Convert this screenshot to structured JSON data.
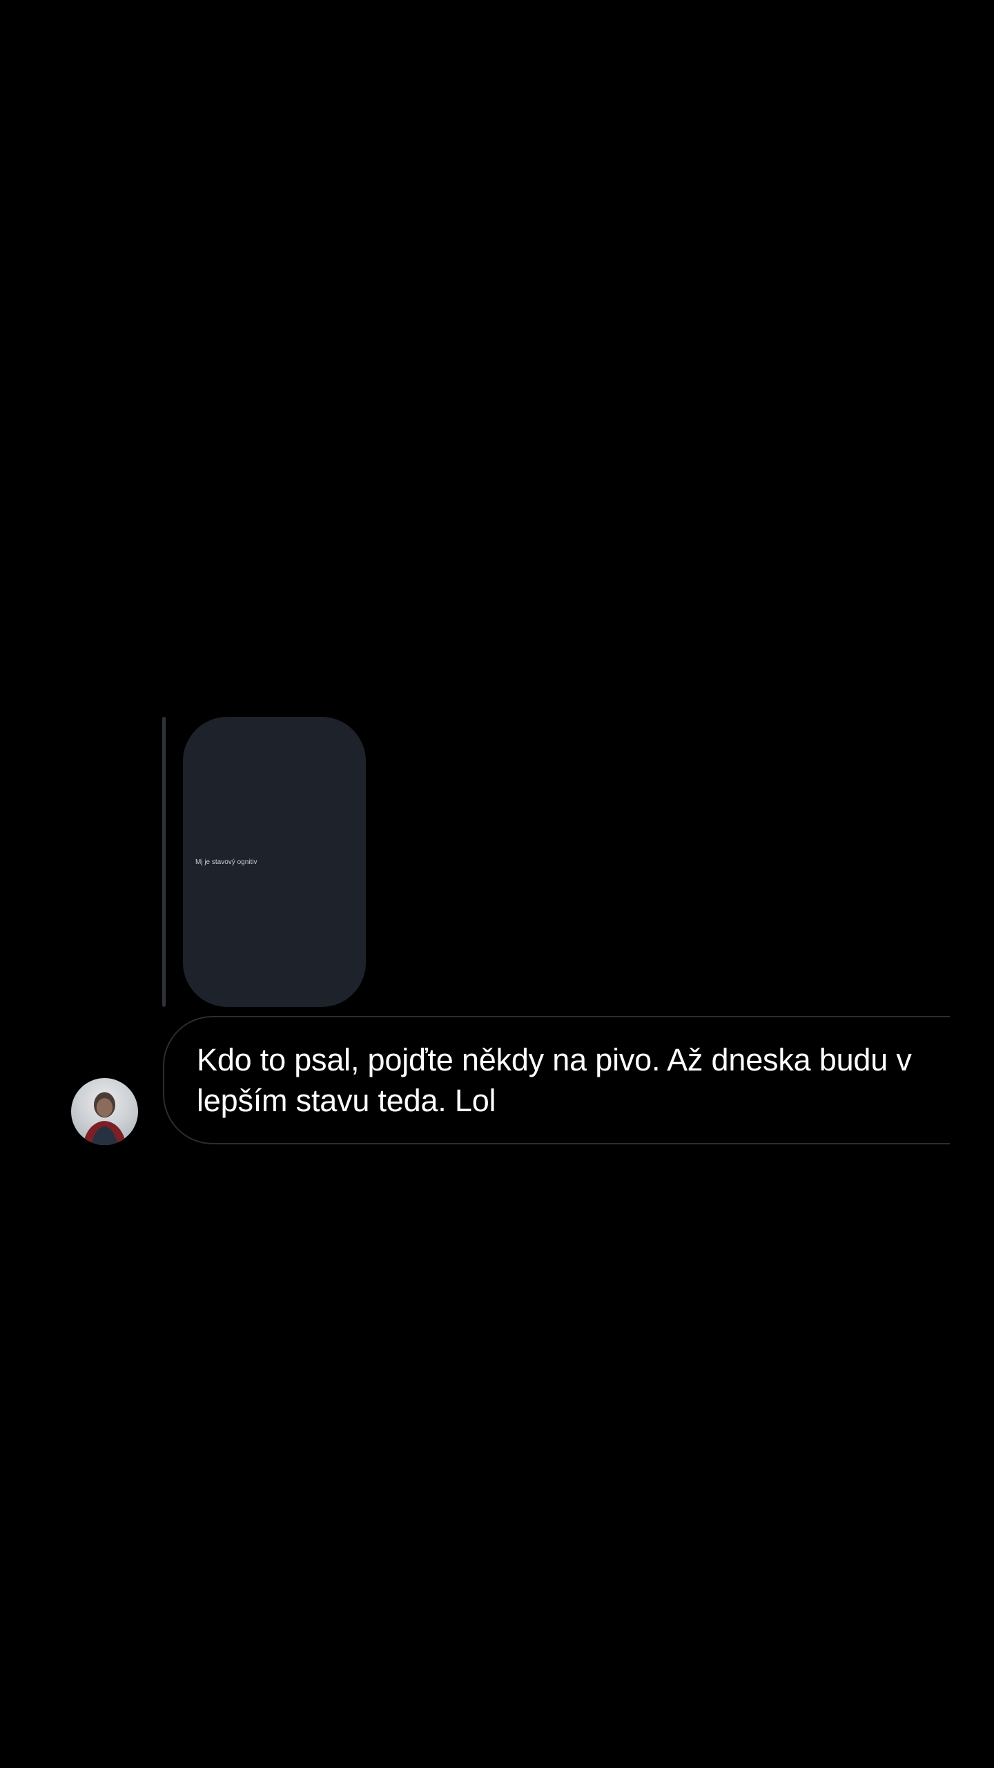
{
  "reply_preview": {
    "text": "Mj je stavový ognitiv"
  },
  "message": {
    "text": "Kdo to psal, pojďte někdy na pivo. Až dneska budu v lepším stavu teda. Lol"
  },
  "colors": {
    "background": "#000000",
    "preview_card": "#1d222b",
    "bubble_border": "#2a2d31",
    "text": "#ffffff"
  },
  "icons": {
    "avatar": "user-avatar-photo"
  }
}
